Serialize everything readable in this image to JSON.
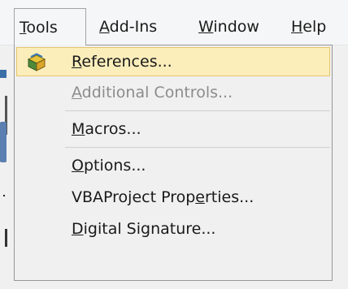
{
  "menubar": {
    "items": [
      {
        "label": "Tools",
        "accel": "T",
        "rest": "ools",
        "open": true
      },
      {
        "label": "Add-Ins",
        "accel": "A",
        "rest": "dd-Ins"
      },
      {
        "label": "Window",
        "accel": "W",
        "rest": "indow"
      },
      {
        "label": "Help",
        "accel": "H",
        "rest": "elp"
      }
    ]
  },
  "tools_menu": {
    "items": [
      {
        "label": "References...",
        "pre": "",
        "accel": "R",
        "post": "eferences...",
        "enabled": true,
        "highlighted": true,
        "icon": "references-book-icon"
      },
      {
        "label": "Additional Controls...",
        "pre": "",
        "accel": "A",
        "post": "dditional Controls...",
        "enabled": false
      },
      {
        "label": "Macros...",
        "pre": "",
        "accel": "M",
        "post": "acros...",
        "enabled": true
      },
      {
        "label": "Options...",
        "pre": "",
        "accel": "O",
        "post": "ptions...",
        "enabled": true
      },
      {
        "label": "VBAProject Properties...",
        "pre": "VBAProject Prop",
        "accel": "e",
        "post": "rties...",
        "enabled": true
      },
      {
        "label": "Digital Signature...",
        "pre": "",
        "accel": "D",
        "post": "igital Signature...",
        "enabled": true
      }
    ]
  },
  "colors": {
    "highlight_bg": "#fbeebb",
    "highlight_border": "#e6c56e",
    "disabled_text": "#8c8c8c"
  }
}
